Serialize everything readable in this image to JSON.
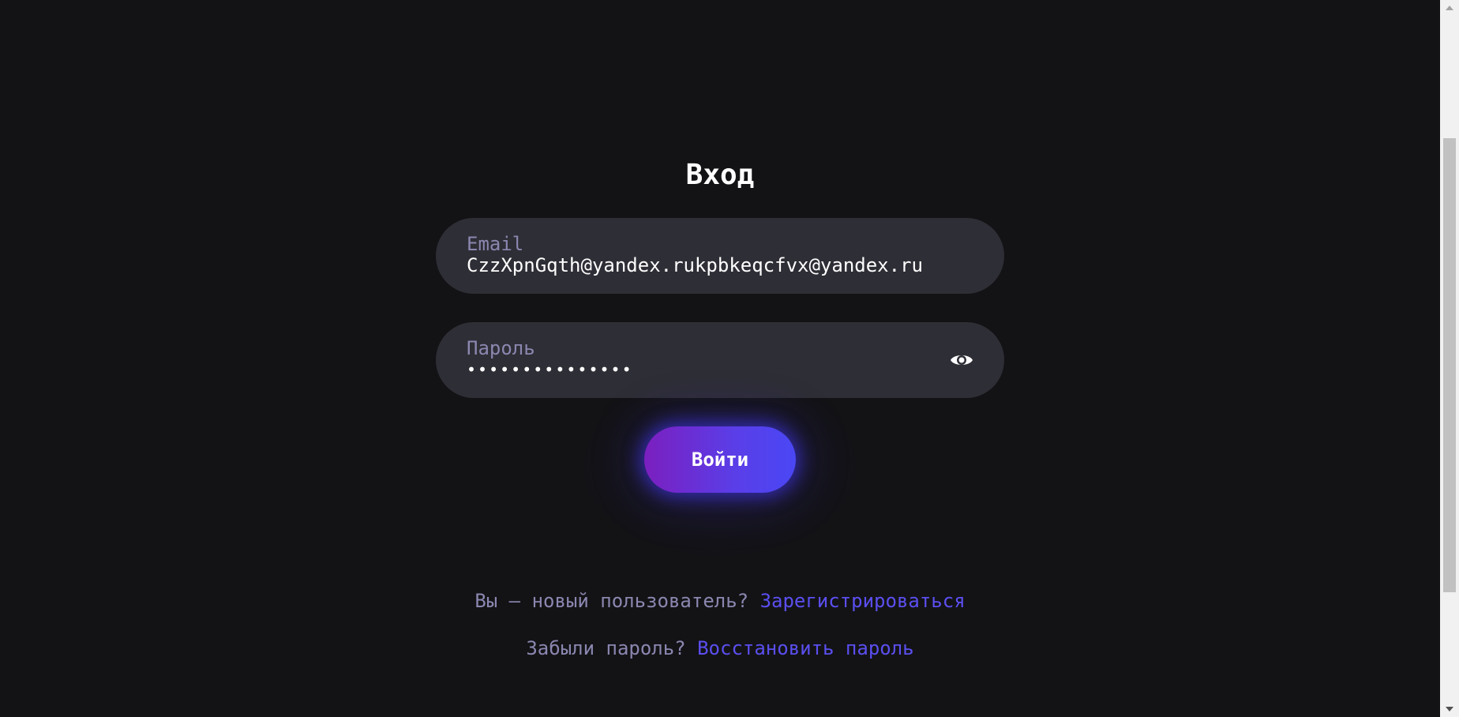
{
  "form": {
    "title": "Вход",
    "email": {
      "label": "Email",
      "value": "CzzXpnGqth@yandex.rukpbkeqcfvx@yandex.ru"
    },
    "password": {
      "label": "Пароль",
      "value_masked": "•••••••••••••••"
    },
    "submit_label": "Войти"
  },
  "footer": {
    "register_prompt": "Вы — новый пользователь?",
    "register_link": "Зарегистрироваться",
    "restore_prompt": "Забыли пароль?",
    "restore_link": "Восстановить пароль"
  },
  "icons": {
    "password_toggle": "eye-icon"
  },
  "colors": {
    "background": "#131316",
    "field_background": "#2e2e36",
    "label": "#8b87b0",
    "link": "#5b4ff0",
    "button_gradient_start": "#7b1fbf",
    "button_gradient_end": "#4a47f5"
  }
}
